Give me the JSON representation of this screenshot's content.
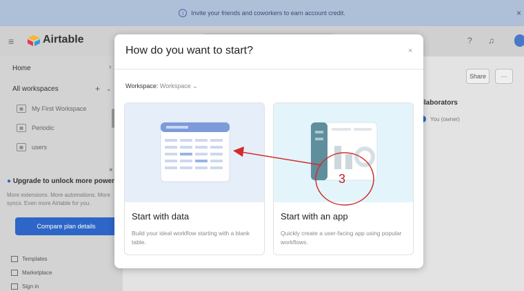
{
  "banner": {
    "text": "Invite your friends and coworkers to earn account credit.",
    "close": "×"
  },
  "header": {
    "brand": "Airtable"
  },
  "sidebar": {
    "home": "Home",
    "all_workspaces": "All workspaces",
    "workspaces": [
      "My First Workspace",
      "Periodic",
      "users"
    ],
    "upgrade_title": "Upgrade to unlock more power",
    "upgrade_sub": "More extensions. More automations. More syncs. Even more Airtable for you.",
    "compare_label": "Compare plan details",
    "bottom_items": [
      "Templates",
      "Marketplace",
      "Sign in"
    ]
  },
  "main": {
    "share_label": "Share",
    "more_label": "···",
    "collaborators_title": "ollaborators",
    "collaborator_user": "You (owner)"
  },
  "modal": {
    "title": "How do you want to start?",
    "close": "×",
    "workspace_label": "Workspace:",
    "workspace_value": "Workspace",
    "cards": [
      {
        "title": "Start with data",
        "desc": "Build your ideal workflow starting with a blank table."
      },
      {
        "title": "Start with an app",
        "desc": "Quickly create a user-facing app using popular workflows."
      }
    ]
  },
  "annotation": {
    "step": "3"
  },
  "colors": {
    "accent": "#2d66c6",
    "annotation_red": "#d22b2b",
    "data_card_bg": "#e6eef9",
    "app_card_bg": "#e3f5fb"
  }
}
